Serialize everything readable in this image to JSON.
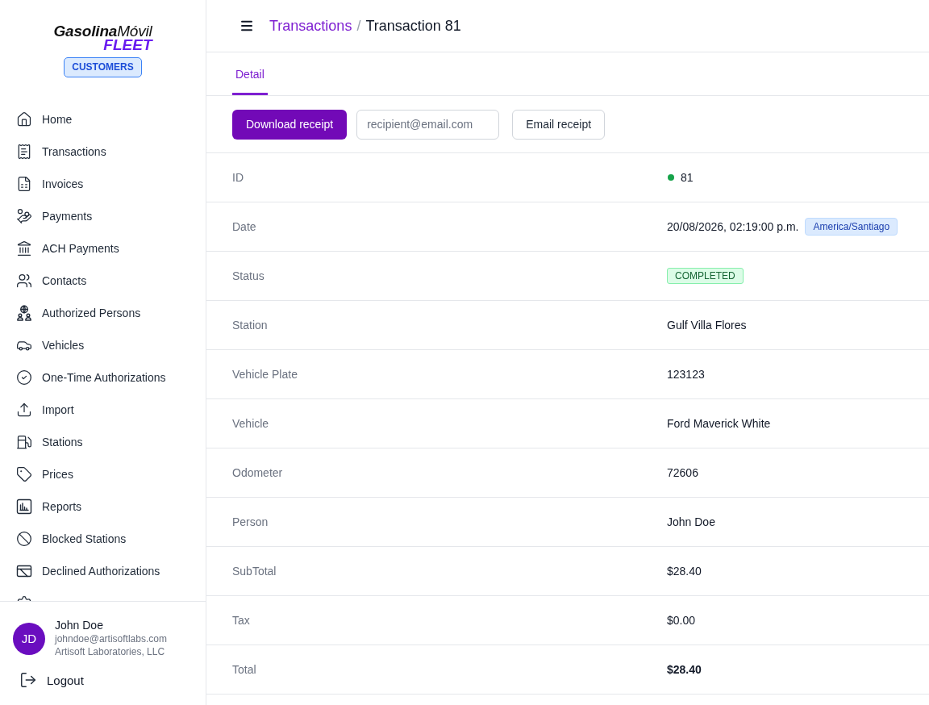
{
  "sidebar": {
    "logo": {
      "wordmark": "**Gasolina**Móvil",
      "product": "FLEET"
    },
    "portal_badge": "CUSTOMERS",
    "nav_items": [
      {
        "label": "Home",
        "selected": false
      },
      {
        "label": "Transactions",
        "selected": false
      },
      {
        "label": "Invoices",
        "selected": false
      },
      {
        "label": "Payments",
        "selected": false
      },
      {
        "label": "ACH Payments",
        "selected": false
      },
      {
        "label": "Contacts",
        "selected": false
      },
      {
        "label": "Authorized Persons",
        "selected": false
      },
      {
        "label": "Vehicles",
        "selected": false
      },
      {
        "label": "One-Time Authorizations",
        "selected": false
      },
      {
        "label": "Import",
        "selected": false
      },
      {
        "label": "Stations",
        "selected": false
      },
      {
        "label": "Prices",
        "selected": false
      },
      {
        "label": "Reports",
        "selected": false
      },
      {
        "label": "Blocked Stations",
        "selected": false
      },
      {
        "label": "Declined Authorizations",
        "selected": false
      },
      {
        "selected": false
      }
    ],
    "user": {
      "initials": "JD",
      "name": "John Doe",
      "email": "johndoe@artisoftlabs.com",
      "company": "Artisoft Laboratories, LLC"
    },
    "logout": "Logout"
  },
  "header": {
    "breadcrumb": [
      {
        "label": "Transactions",
        "kind": "link"
      },
      {
        "label": "Transaction 81",
        "kind": "current"
      }
    ],
    "separator": "/"
  },
  "tabs": [
    {
      "label": "Detail",
      "selected": true
    }
  ],
  "actions": {
    "download_button": "Download receipt",
    "email_field": {
      "placeholder": "recipient@email.com"
    },
    "email_button": "Email receipt"
  },
  "details": [
    {
      "label": "ID",
      "value": "81",
      "kind": "status_dot",
      "color": "#16a34a"
    },
    {
      "label": "Date",
      "value": "20/08/2026, 02:19:00 p.m.",
      "kind": "datetime",
      "timezone": "America/Santiago"
    },
    {
      "label": "Status",
      "value": "COMPLETED",
      "kind": "badge"
    },
    {
      "label": "Station",
      "value": "Gulf Villa Flores",
      "kind": "text"
    },
    {
      "label": "Vehicle Plate",
      "value": "123123",
      "kind": "text"
    },
    {
      "label": "Vehicle",
      "value": "Ford Maverick White",
      "kind": "text"
    },
    {
      "label": "Odometer",
      "value": "72606",
      "kind": "text"
    },
    {
      "label": "Person",
      "value": "John Doe",
      "kind": "text"
    },
    {
      "label": "SubTotal",
      "value": "$28.40",
      "kind": "text"
    },
    {
      "label": "Tax",
      "value": "$0.00",
      "kind": "text"
    },
    {
      "label": "Total",
      "value": "$28.40",
      "kind": "total"
    }
  ]
}
